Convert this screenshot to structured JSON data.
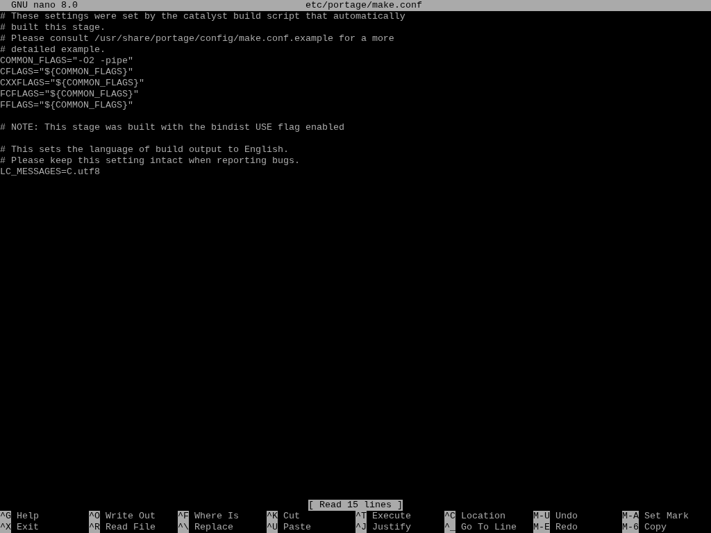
{
  "title_bar": {
    "app": "GNU nano 8.0",
    "file": "etc/portage/make.conf"
  },
  "lines": [
    {
      "kind": "text",
      "text": "# These settings were set by the catalyst build script that automatically"
    },
    {
      "kind": "text",
      "text": "# built this stage."
    },
    {
      "kind": "text",
      "text": "# Please consult /usr/share/portage/config/make.conf.example for a more"
    },
    {
      "kind": "text",
      "text": "# detailed example."
    },
    {
      "kind": "text",
      "text": "COMMON_FLAGS=\"-O2 -pipe\""
    },
    {
      "kind": "text",
      "text": "CFLAGS=\"${COMMON_FLAGS}\""
    },
    {
      "kind": "text",
      "text": "CXXFLAGS=\"${COMMON_FLAGS}\""
    },
    {
      "kind": "text",
      "text": "FCFLAGS=\"${COMMON_FLAGS}\""
    },
    {
      "kind": "text",
      "text": "FFLAGS=\"${COMMON_FLAGS}\""
    },
    {
      "kind": "blank"
    },
    {
      "kind": "text",
      "text": "# NOTE: This stage was built with the bindist USE flag enabled"
    },
    {
      "kind": "blank"
    },
    {
      "kind": "text",
      "text": "# This sets the language of build output to English."
    },
    {
      "kind": "text",
      "text": "# Please keep this setting intact when reporting bugs."
    },
    {
      "kind": "text",
      "text": "LC_MESSAGES=C.utf8"
    }
  ],
  "status": "[ Read 15 lines ]",
  "shortcuts": [
    [
      {
        "key": "^G",
        "label": "Help"
      },
      {
        "key": "^O",
        "label": "Write Out"
      },
      {
        "key": "^F",
        "label": "Where Is"
      },
      {
        "key": "^K",
        "label": "Cut"
      },
      {
        "key": "^T",
        "label": "Execute"
      },
      {
        "key": "^C",
        "label": "Location"
      },
      {
        "key": "M-U",
        "label": "Undo"
      },
      {
        "key": "M-A",
        "label": "Set Mark"
      }
    ],
    [
      {
        "key": "^X",
        "label": "Exit"
      },
      {
        "key": "^R",
        "label": "Read File"
      },
      {
        "key": "^\\",
        "label": "Replace"
      },
      {
        "key": "^U",
        "label": "Paste"
      },
      {
        "key": "^J",
        "label": "Justify"
      },
      {
        "key": "^_",
        "label": "Go To Line"
      },
      {
        "key": "M-E",
        "label": "Redo"
      },
      {
        "key": "M-6",
        "label": "Copy"
      }
    ]
  ]
}
